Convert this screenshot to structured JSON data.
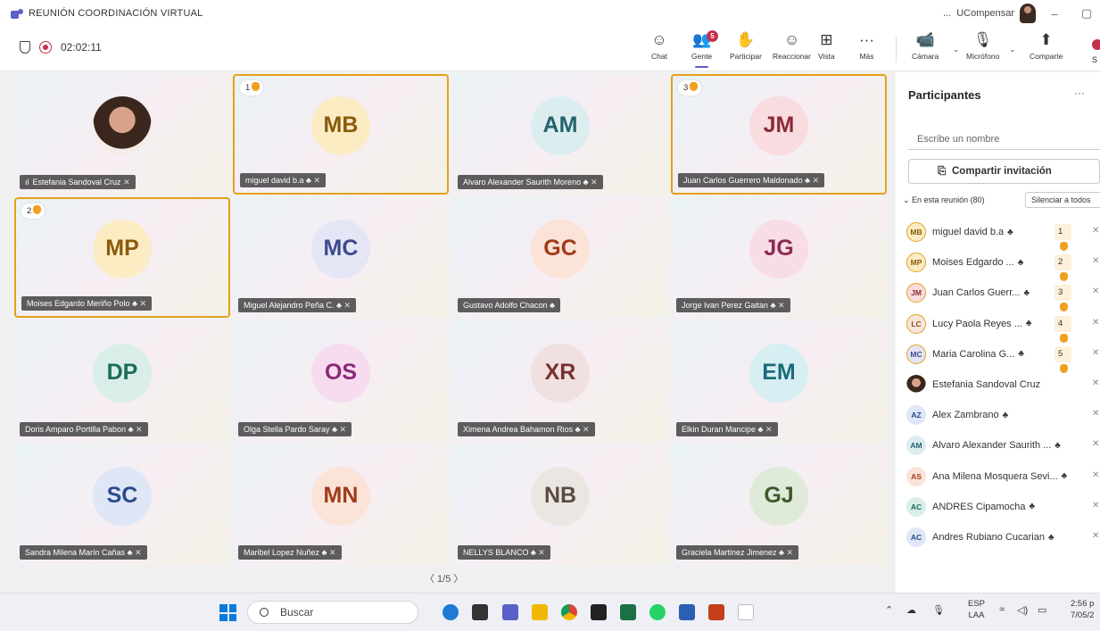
{
  "window": {
    "title": "REUNIÓN COORDINACIÓN VIRTUAL",
    "more": "...",
    "org": "UCompensar",
    "minimize": "–",
    "restore": "▢"
  },
  "toolbar": {
    "timer": "02:02:11",
    "buttons": [
      {
        "label": "Chat",
        "icon": "☺"
      },
      {
        "label": "Gente",
        "icon": "👥",
        "badge": "5"
      },
      {
        "label": "Participar",
        "icon": "✋"
      },
      {
        "label": "Reaccionar",
        "icon": "☺"
      },
      {
        "label": "Vista",
        "icon": "⊞"
      },
      {
        "label": "Más",
        "icon": "···"
      },
      {
        "label": "Cámara",
        "icon": "📹"
      },
      {
        "label": "Micrófono",
        "icon": "🎙"
      },
      {
        "label": "Comparte",
        "icon": "⬆"
      }
    ],
    "leave_partial": "S"
  },
  "tiles": [
    {
      "initials": "",
      "name": "Estefania Sandoval Cruz",
      "photo": true,
      "bg": "#ffffff",
      "fg": "#333333",
      "hand": "",
      "signal": "ıl"
    },
    {
      "initials": "MB",
      "name": "miguel david b.a",
      "bg": "#fbecc4",
      "fg": "#8a5a0b",
      "hand": "1"
    },
    {
      "initials": "AM",
      "name": "Alvaro Alexander Saurith Moreno",
      "bg": "#dcedf0",
      "fg": "#23636c",
      "hand": ""
    },
    {
      "initials": "JM",
      "name": "Juan Carlos Guerrero Maldonado",
      "bg": "#f8dcdf",
      "fg": "#8c2b36",
      "hand": "3"
    },
    {
      "initials": "MP",
      "name": "Moises Edgardo Meriño Polo",
      "bg": "#fbecc4",
      "fg": "#8a5a0b",
      "hand": "2"
    },
    {
      "initials": "MC",
      "name": "Miguel Alejandro Peña C.",
      "bg": "#e4e6f5",
      "fg": "#3e4a8c",
      "hand": ""
    },
    {
      "initials": "GC",
      "name": "Gustavo Adolfo Chacon",
      "bg": "#fbe3d8",
      "fg": "#a03b1a",
      "hand": ""
    },
    {
      "initials": "JG",
      "name": "Jorge Ivan Perez Gaitan",
      "bg": "#f8dce6",
      "fg": "#8c2b52",
      "hand": ""
    },
    {
      "initials": "DP",
      "name": "Doris Amparo Portilla Pabon",
      "bg": "#d9eee9",
      "fg": "#1b6b5a",
      "hand": ""
    },
    {
      "initials": "OS",
      "name": "Olga Stella Pardo Saray",
      "bg": "#f6dcee",
      "fg": "#8a2a78",
      "hand": ""
    },
    {
      "initials": "XR",
      "name": "Ximena Andrea Bahamon Rios",
      "bg": "#f0e0e0",
      "fg": "#7a3030",
      "hand": ""
    },
    {
      "initials": "EM",
      "name": "Elkin Duran Mancipe",
      "bg": "#d7eef2",
      "fg": "#1b6a78",
      "hand": ""
    },
    {
      "initials": "SC",
      "name": "Sandra Milena Marín Cañas",
      "bg": "#dfe6f6",
      "fg": "#2a4b8c",
      "hand": ""
    },
    {
      "initials": "MN",
      "name": "Maribel Lopez Nuñez",
      "bg": "#fbe3d8",
      "fg": "#a03b1a",
      "hand": ""
    },
    {
      "initials": "NB",
      "name": "NELLYS BLANCO",
      "bg": "#ece6e3",
      "fg": "#5a4a44",
      "hand": ""
    },
    {
      "initials": "GJ",
      "name": "Graciela Martinez Jimenez",
      "bg": "#e0ead9",
      "fg": "#3c5a2a",
      "hand": ""
    }
  ],
  "pager": "〈  1/5  〉",
  "panel": {
    "title": "Participantes",
    "more": "···",
    "search_placeholder": "Escribe un nombre",
    "invite": "Compartir invitación",
    "section": "⌄  En esta reunión (80)",
    "mute_all": "Silenciar a todos",
    "participants": [
      {
        "initials": "MB",
        "name": "miguel david b.a",
        "bg": "#fbecc4",
        "fg": "#8a5a0b",
        "ring": true,
        "hand": "1",
        "org": true
      },
      {
        "initials": "MP",
        "name": "Moises Edgardo ...",
        "bg": "#fbecc4",
        "fg": "#8a5a0b",
        "ring": true,
        "hand": "2",
        "org": true
      },
      {
        "initials": "JM",
        "name": "Juan Carlos Guerr...",
        "bg": "#f8dcdf",
        "fg": "#8c2b36",
        "ring": true,
        "hand": "3",
        "org": true
      },
      {
        "initials": "LC",
        "name": "Lucy Paola Reyes ...",
        "bg": "#f6e6dc",
        "fg": "#8c4a2b",
        "ring": true,
        "hand": "4",
        "org": true
      },
      {
        "initials": "MC",
        "name": "Maria Carolina G...",
        "bg": "#e4e6f5",
        "fg": "#3e4a8c",
        "ring": true,
        "hand": "5",
        "org": true
      },
      {
        "initials": "",
        "name": "Estefania Sandoval Cruz",
        "photo": true,
        "bg": "#ffffff",
        "fg": "#333333",
        "hand": "",
        "org": false
      },
      {
        "initials": "AZ",
        "name": "Alex Zambrano",
        "bg": "#dfe6f6",
        "fg": "#2a4b8c",
        "hand": "",
        "org": true
      },
      {
        "initials": "AM",
        "name": "Alvaro Alexander Saurith ...",
        "bg": "#dcedf0",
        "fg": "#23636c",
        "hand": "",
        "org": true
      },
      {
        "initials": "AS",
        "name": "Ana Milena Mosquera Sevi...",
        "bg": "#fbe3d8",
        "fg": "#a03b1a",
        "hand": "",
        "org": true
      },
      {
        "initials": "AC",
        "name": "ANDRES Cipamocha",
        "bg": "#d9eee9",
        "fg": "#1b6b5a",
        "hand": "",
        "org": true
      },
      {
        "initials": "AC",
        "name": "Andres Rubiano Cucarian",
        "bg": "#dfe6f6",
        "fg": "#2a4b8c",
        "hand": "",
        "org": true
      }
    ]
  },
  "taskbar": {
    "search": "Buscar",
    "lang": "ESP",
    "lang2": "LAA",
    "time": "2:56 p",
    "date": "7/05/2"
  }
}
